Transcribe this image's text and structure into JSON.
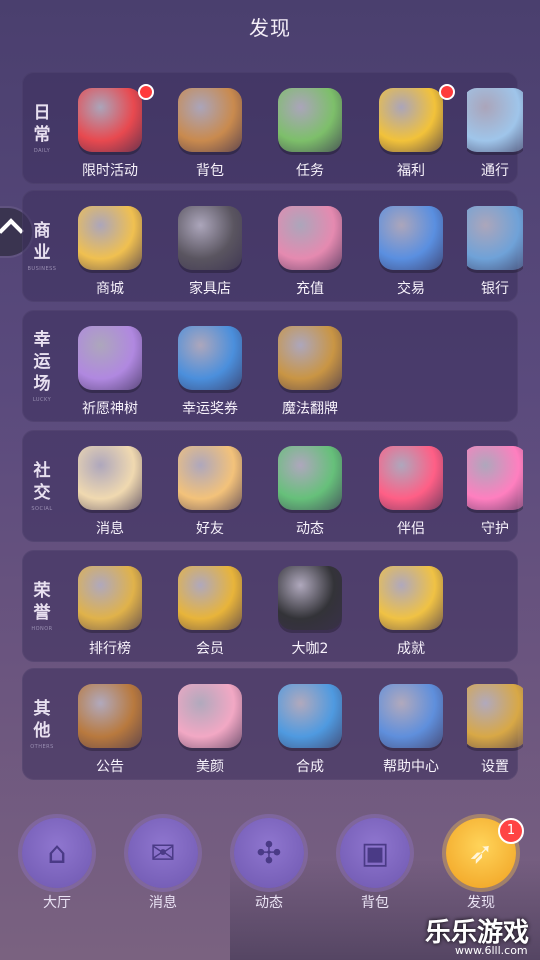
{
  "title": "发现",
  "categories": [
    {
      "label": "日常",
      "sub": "DAILY",
      "items": [
        {
          "label": "限时活动",
          "dot": true,
          "icon": "activity-sign-icon",
          "color": "#e8494f"
        },
        {
          "label": "背包",
          "dot": false,
          "icon": "backpack-icon",
          "color": "#c98a4e"
        },
        {
          "label": "任务",
          "dot": false,
          "icon": "clipboard-icon",
          "color": "#7dbf6a"
        },
        {
          "label": "福利",
          "dot": true,
          "icon": "gift-box-icon",
          "color": "#f2c23a"
        },
        {
          "label": "通行",
          "dot": false,
          "icon": "ticket-pass-icon",
          "color": "#9fc5ea"
        }
      ]
    },
    {
      "label": "商业",
      "sub": "BUSINESS",
      "items": [
        {
          "label": "商城",
          "dot": false,
          "icon": "shop-icon",
          "color": "#f0c050"
        },
        {
          "label": "家具店",
          "dot": false,
          "icon": "sofa-bear-icon",
          "color": "#5a5560"
        },
        {
          "label": "充值",
          "dot": false,
          "icon": "recharge-wallet-icon",
          "color": "#e58ab0"
        },
        {
          "label": "交易",
          "dot": false,
          "icon": "money-wallet-icon",
          "color": "#5a8fe0"
        },
        {
          "label": "银行",
          "dot": false,
          "icon": "bank-safe-icon",
          "color": "#6fa2d8"
        }
      ]
    },
    {
      "label": "幸运场",
      "sub": "LUCKY",
      "items": [
        {
          "label": "祈愿神树",
          "dot": false,
          "icon": "wish-tree-icon",
          "color": "#b088e0"
        },
        {
          "label": "幸运奖券",
          "dot": false,
          "icon": "lottery-tickets-icon",
          "color": "#4b8fdc"
        },
        {
          "label": "魔法翻牌",
          "dot": false,
          "icon": "magic-cards-icon",
          "color": "#c99544"
        }
      ]
    },
    {
      "label": "社交",
      "sub": "SOCIAL",
      "items": [
        {
          "label": "消息",
          "dot": false,
          "icon": "letter-icon",
          "color": "#f0d9b0"
        },
        {
          "label": "好友",
          "dot": false,
          "icon": "friends-icon",
          "color": "#f3c27a"
        },
        {
          "label": "动态",
          "dot": false,
          "icon": "pinwheel-icon",
          "color": "#66c07a"
        },
        {
          "label": "伴侣",
          "dot": false,
          "icon": "hearts-icon",
          "color": "#ff5f86"
        },
        {
          "label": "守护",
          "dot": false,
          "icon": "winged-star-icon",
          "color": "#ff7fbf"
        }
      ]
    },
    {
      "label": "荣誉",
      "sub": "HONOR",
      "items": [
        {
          "label": "排行榜",
          "dot": false,
          "icon": "star-badge-icon",
          "color": "#e0b24a"
        },
        {
          "label": "会员",
          "dot": false,
          "icon": "crown-icon",
          "color": "#e8b43a"
        },
        {
          "label": "大咖2",
          "dot": false,
          "icon": "top-hat-icon",
          "color": "#333338"
        },
        {
          "label": "成就",
          "dot": false,
          "icon": "trophy-icon",
          "color": "#f0c244"
        }
      ]
    },
    {
      "label": "其他",
      "sub": "OTHERS",
      "items": [
        {
          "label": "公告",
          "dot": false,
          "icon": "bell-board-icon",
          "color": "#b8793e"
        },
        {
          "label": "美颜",
          "dot": false,
          "icon": "palette-icon",
          "color": "#f2a8c4"
        },
        {
          "label": "合成",
          "dot": false,
          "icon": "synthesis-hex-icon",
          "color": "#4f9ae0"
        },
        {
          "label": "帮助中心",
          "dot": false,
          "icon": "help-book-icon",
          "color": "#5f8fdc"
        },
        {
          "label": "设置",
          "dot": false,
          "icon": "gear-icon",
          "color": "#d8a846"
        }
      ]
    }
  ],
  "nav": [
    {
      "label": "大厅",
      "icon": "house-icon",
      "active": false
    },
    {
      "label": "消息",
      "icon": "mail-icon",
      "active": false
    },
    {
      "label": "动态",
      "icon": "fan-icon",
      "active": false
    },
    {
      "label": "背包",
      "icon": "bag-icon",
      "active": false
    },
    {
      "label": "发现",
      "icon": "compass-icon",
      "active": true,
      "badge": "1"
    }
  ],
  "watermark": {
    "name": "乐乐游戏",
    "url": "www.6lll.com"
  }
}
